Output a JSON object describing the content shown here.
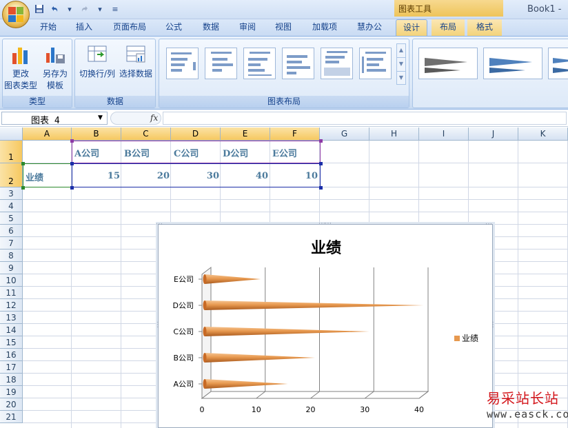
{
  "titlebar": {
    "tools_banner": "图表工具",
    "window_title": "Book1 -",
    "qat": {
      "save_icon": "save-icon",
      "undo_icon": "undo-icon",
      "redo_icon": "redo-icon",
      "customize_icon": "dropdown-icon"
    }
  },
  "tabs": [
    {
      "label": "开始"
    },
    {
      "label": "插入"
    },
    {
      "label": "页面布局"
    },
    {
      "label": "公式"
    },
    {
      "label": "数据"
    },
    {
      "label": "审阅"
    },
    {
      "label": "视图"
    },
    {
      "label": "加载项"
    },
    {
      "label": "慧办公"
    },
    {
      "label": "设计"
    },
    {
      "label": "布局"
    },
    {
      "label": "格式"
    }
  ],
  "ribbon": {
    "group_type": {
      "label": "类型",
      "change_type": "更改\n图表类型",
      "change_type_l1": "更改",
      "change_type_l2": "图表类型",
      "save_template_l1": "另存为",
      "save_template_l2": "模板"
    },
    "group_data": {
      "label": "数据",
      "switch_row_col": "切换行/列",
      "select_data": "选择数据"
    },
    "group_layout": {
      "label": "图表布局"
    }
  },
  "formula_bar": {
    "name_box": "图表 4",
    "fx": "fx",
    "formula": ""
  },
  "sheet": {
    "columns": [
      "A",
      "B",
      "C",
      "D",
      "E",
      "F",
      "G",
      "H",
      "I",
      "J",
      "K"
    ],
    "rows": [
      "1",
      "2",
      "3",
      "4",
      "5",
      "6",
      "7",
      "8",
      "9",
      "10",
      "11",
      "12",
      "13",
      "14",
      "15",
      "16",
      "17",
      "18",
      "19",
      "20",
      "21"
    ],
    "row1": [
      "A公司",
      "B公司",
      "C公司",
      "D公司",
      "E公司"
    ],
    "row2_label": "业绩",
    "row2": [
      "15",
      "20",
      "30",
      "40",
      "10"
    ]
  },
  "chart_data": {
    "type": "bar",
    "title": "业绩",
    "categories": [
      "A公司",
      "B公司",
      "C公司",
      "D公司",
      "E公司"
    ],
    "series": [
      {
        "name": "业绩",
        "values": [
          15,
          20,
          30,
          40,
          10
        ]
      }
    ],
    "xlim": [
      0,
      40
    ],
    "xticks": [
      0,
      10,
      20,
      30,
      40
    ],
    "orientation": "horizontal",
    "style": "3d-cone",
    "grid": true,
    "legend": "right",
    "color": "#e7994f"
  },
  "watermark": {
    "text": "易采站长站",
    "url": "www.easck.com"
  }
}
